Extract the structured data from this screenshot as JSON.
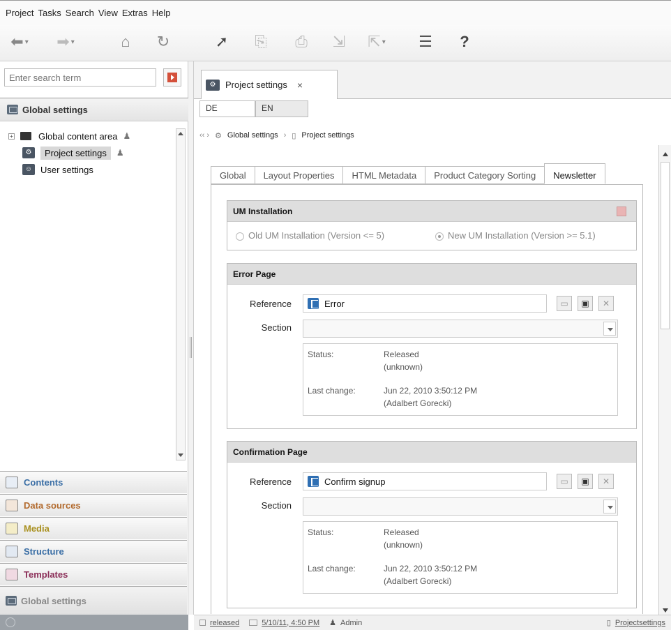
{
  "menu": {
    "items": [
      "Project",
      "Tasks",
      "Search",
      "View",
      "Extras",
      "Help"
    ]
  },
  "toolbar": {
    "icons": [
      "back-arrow-icon",
      "forward-arrow-icon",
      "home-icon",
      "refresh-icon",
      "pointer-icon",
      "page-icon",
      "print-icon",
      "export-icon",
      "import-icon",
      "checklist-icon",
      "help-icon"
    ],
    "help_glyph": "?"
  },
  "search": {
    "placeholder": "Enter search term"
  },
  "left": {
    "header": "Global settings",
    "tree": [
      {
        "label": "Global content area",
        "toggle": "+"
      },
      {
        "label": "Project settings"
      },
      {
        "label": "User settings"
      }
    ],
    "nav": [
      {
        "label": "Contents",
        "color": "#3a6ea5"
      },
      {
        "label": "Data sources",
        "color": "#b26a2d"
      },
      {
        "label": "Media",
        "color": "#a9901f"
      },
      {
        "label": "Structure",
        "color": "#3a6ea5"
      },
      {
        "label": "Templates",
        "color": "#8b2e58"
      },
      {
        "label": "Global settings",
        "color": "#888888"
      }
    ]
  },
  "main": {
    "tab_label": "Project settings",
    "tab_close": "×",
    "langs": [
      "DE",
      "EN"
    ],
    "breadcrumb": {
      "first": "Global settings",
      "second": "Project settings",
      "nav_glyph": "‹‹ ›",
      "sep": "›"
    },
    "tabs": [
      "Global",
      "Layout Properties",
      "HTML Metadata",
      "Product Category Sorting",
      "Newsletter"
    ],
    "um": {
      "title": "UM Installation",
      "opt1": "Old UM Installation (Version <= 5)",
      "opt2": "New UM Installation (Version >= 5.1)"
    },
    "error_page": {
      "title": "Error Page",
      "reference_label": "Reference",
      "reference_value": "Error",
      "section_label": "Section",
      "status_label": "Status:",
      "status_value": "Released",
      "status_sub": "(unknown)",
      "change_label": "Last change:",
      "change_value": "Jun 22, 2010 3:50:12 PM",
      "change_user": "(Adalbert Gorecki)"
    },
    "confirmation_page": {
      "title": "Confirmation Page",
      "reference_label": "Reference",
      "reference_value": "Confirm signup",
      "section_label": "Section",
      "status_label": "Status:",
      "status_value": "Released",
      "status_sub": "(unknown)",
      "change_label": "Last change:",
      "change_value": "Jun 22, 2010 3:50:12 PM",
      "change_user": "(Adalbert Gorecki)"
    }
  },
  "statusbar": {
    "state": "released",
    "date": "5/10/11, 4:50 PM",
    "user": "Admin",
    "right": "Projectsettings"
  }
}
